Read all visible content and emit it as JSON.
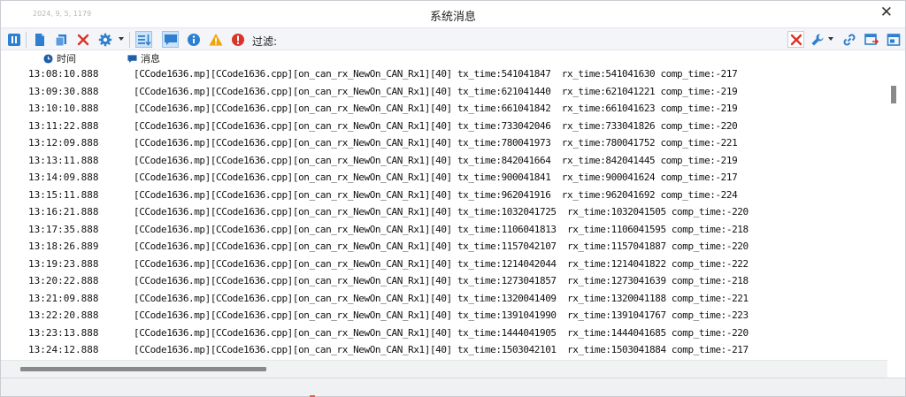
{
  "window": {
    "title": "系统消息",
    "faded_text": "2024, 9, 5, 1179",
    "close_glyph": "✕"
  },
  "toolbar": {
    "filter_label": "过滤:",
    "colors": {
      "accent_blue": "#2f7fd0",
      "red": "#d9342b",
      "warning": "#f0a30a"
    },
    "icons_left": [
      "pause-icon",
      "document-icon",
      "copy-icon",
      "delete-icon",
      "settings-icon",
      "sort-icon",
      "message-icon",
      "info-icon",
      "warning-icon",
      "error-icon"
    ],
    "icons_right": [
      "clear-filter-icon",
      "wrench-icon",
      "link-icon",
      "export-icon",
      "window-icon"
    ]
  },
  "columns": {
    "time": "时间",
    "message": "消息"
  },
  "log": {
    "rows": [
      {
        "time": "13:08:10.888",
        "msg": "[CCode1636.mp][CCode1636.cpp][on_can_rx_NewOn_CAN_Rx1][40] tx_time:541041847  rx_time:541041630 comp_time:-217"
      },
      {
        "time": "13:09:30.888",
        "msg": "[CCode1636.mp][CCode1636.cpp][on_can_rx_NewOn_CAN_Rx1][40] tx_time:621041440  rx_time:621041221 comp_time:-219"
      },
      {
        "time": "13:10:10.888",
        "msg": "[CCode1636.mp][CCode1636.cpp][on_can_rx_NewOn_CAN_Rx1][40] tx_time:661041842  rx_time:661041623 comp_time:-219"
      },
      {
        "time": "13:11:22.888",
        "msg": "[CCode1636.mp][CCode1636.cpp][on_can_rx_NewOn_CAN_Rx1][40] tx_time:733042046  rx_time:733041826 comp_time:-220"
      },
      {
        "time": "13:12:09.888",
        "msg": "[CCode1636.mp][CCode1636.cpp][on_can_rx_NewOn_CAN_Rx1][40] tx_time:780041973  rx_time:780041752 comp_time:-221"
      },
      {
        "time": "13:13:11.888",
        "msg": "[CCode1636.mp][CCode1636.cpp][on_can_rx_NewOn_CAN_Rx1][40] tx_time:842041664  rx_time:842041445 comp_time:-219"
      },
      {
        "time": "13:14:09.888",
        "msg": "[CCode1636.mp][CCode1636.cpp][on_can_rx_NewOn_CAN_Rx1][40] tx_time:900041841  rx_time:900041624 comp_time:-217"
      },
      {
        "time": "13:15:11.888",
        "msg": "[CCode1636.mp][CCode1636.cpp][on_can_rx_NewOn_CAN_Rx1][40] tx_time:962041916  rx_time:962041692 comp_time:-224"
      },
      {
        "time": "13:16:21.888",
        "msg": "[CCode1636.mp][CCode1636.cpp][on_can_rx_NewOn_CAN_Rx1][40] tx_time:1032041725  rx_time:1032041505 comp_time:-220"
      },
      {
        "time": "13:17:35.888",
        "msg": "[CCode1636.mp][CCode1636.cpp][on_can_rx_NewOn_CAN_Rx1][40] tx_time:1106041813  rx_time:1106041595 comp_time:-218"
      },
      {
        "time": "13:18:26.889",
        "msg": "[CCode1636.mp][CCode1636.cpp][on_can_rx_NewOn_CAN_Rx1][40] tx_time:1157042107  rx_time:1157041887 comp_time:-220"
      },
      {
        "time": "13:19:23.888",
        "msg": "[CCode1636.mp][CCode1636.cpp][on_can_rx_NewOn_CAN_Rx1][40] tx_time:1214042044  rx_time:1214041822 comp_time:-222"
      },
      {
        "time": "13:20:22.888",
        "msg": "[CCode1636.mp][CCode1636.cpp][on_can_rx_NewOn_CAN_Rx1][40] tx_time:1273041857  rx_time:1273041639 comp_time:-218"
      },
      {
        "time": "13:21:09.888",
        "msg": "[CCode1636.mp][CCode1636.cpp][on_can_rx_NewOn_CAN_Rx1][40] tx_time:1320041409  rx_time:1320041188 comp_time:-221"
      },
      {
        "time": "13:22:20.888",
        "msg": "[CCode1636.mp][CCode1636.cpp][on_can_rx_NewOn_CAN_Rx1][40] tx_time:1391041990  rx_time:1391041767 comp_time:-223"
      },
      {
        "time": "13:23:13.888",
        "msg": "[CCode1636.mp][CCode1636.cpp][on_can_rx_NewOn_CAN_Rx1][40] tx_time:1444041905  rx_time:1444041685 comp_time:-220"
      },
      {
        "time": "13:24:12.888",
        "msg": "[CCode1636.mp][CCode1636.cpp][on_can_rx_NewOn_CAN_Rx1][40] tx_time:1503042101  rx_time:1503041884 comp_time:-217"
      }
    ]
  }
}
